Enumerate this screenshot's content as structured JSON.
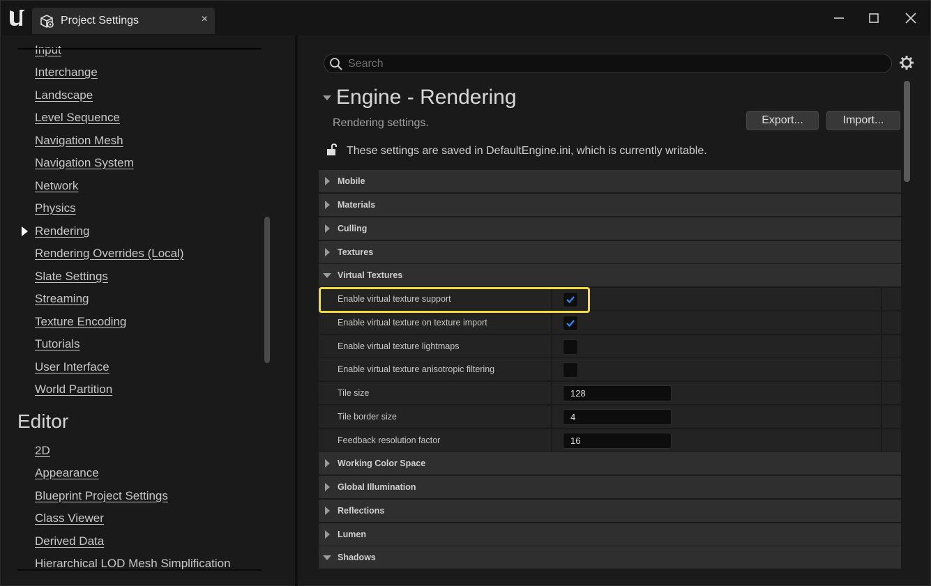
{
  "window": {
    "tab_title": "Project Settings",
    "tab_close_glyph": "×",
    "controls": {
      "minimize": "minimize-icon",
      "maximize": "maximize-icon",
      "close": "close-icon"
    }
  },
  "sidebar": {
    "items_top": [
      "Input",
      "Interchange",
      "Landscape",
      "Level Sequence",
      "Navigation Mesh",
      "Navigation System",
      "Network",
      "Physics",
      "Rendering",
      "Rendering Overrides (Local)",
      "Slate Settings",
      "Streaming",
      "Texture Encoding",
      "Tutorials",
      "User Interface",
      "World Partition"
    ],
    "selected": "Rendering",
    "editor_heading": "Editor",
    "items_editor": [
      "2D",
      "Appearance",
      "Blueprint Project Settings",
      "Class Viewer",
      "Derived Data",
      "Hierarchical LOD Mesh Simplification"
    ]
  },
  "main": {
    "search_placeholder": "Search",
    "section_title": "Engine - Rendering",
    "section_desc": "Rendering settings.",
    "export_label": "Export...",
    "import_label": "Import...",
    "writable_note": "These settings are saved in DefaultEngine.ini, which is currently writable.",
    "categories_before": [
      "Mobile",
      "Materials",
      "Culling",
      "Textures"
    ],
    "expanded_category": "Virtual Textures",
    "properties": [
      {
        "label": "Enable virtual texture support",
        "type": "checkbox",
        "checked": true
      },
      {
        "label": "Enable virtual texture on texture import",
        "type": "checkbox",
        "checked": true
      },
      {
        "label": "Enable virtual texture lightmaps",
        "type": "checkbox",
        "checked": false
      },
      {
        "label": "Enable virtual texture anisotropic filtering",
        "type": "checkbox",
        "checked": false
      },
      {
        "label": "Tile size",
        "type": "number",
        "value": "128"
      },
      {
        "label": "Tile border size",
        "type": "number",
        "value": "4"
      },
      {
        "label": "Feedback resolution factor",
        "type": "number",
        "value": "16"
      }
    ],
    "categories_after": [
      "Working Color Space",
      "Global Illumination",
      "Reflections",
      "Lumen"
    ],
    "last_category": "Shadows"
  },
  "colors": {
    "highlight": "#f2dc3e",
    "check_accent": "#2f8bff",
    "background": "#1a1a1a"
  }
}
